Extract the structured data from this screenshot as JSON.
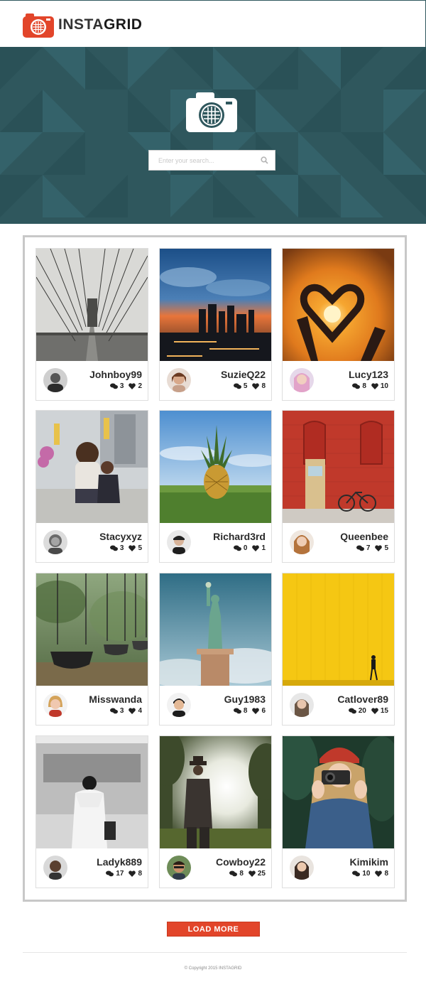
{
  "brand": {
    "insta": "INSTA",
    "grid": "GRID",
    "accent": "#e2452a",
    "hero_color": "#2f575d"
  },
  "search": {
    "placeholder": "Enter your search...",
    "icon": "search-icon"
  },
  "cards": [
    {
      "user": "Johnboy99",
      "comments": "3",
      "likes": "2"
    },
    {
      "user": "SuzieQ22",
      "comments": "5",
      "likes": "8"
    },
    {
      "user": "Lucy123",
      "comments": "8",
      "likes": "10"
    },
    {
      "user": "Stacyxyz",
      "comments": "3",
      "likes": "5"
    },
    {
      "user": "Richard3rd",
      "comments": "0",
      "likes": "1"
    },
    {
      "user": "Queenbee",
      "comments": "7",
      "likes": "5"
    },
    {
      "user": "Misswanda",
      "comments": "3",
      "likes": "4"
    },
    {
      "user": "Guy1983",
      "comments": "8",
      "likes": "6"
    },
    {
      "user": "Catlover89",
      "comments": "20",
      "likes": "15"
    },
    {
      "user": "Ladyk889",
      "comments": "17",
      "likes": "8"
    },
    {
      "user": "Cowboy22",
      "comments": "8",
      "likes": "25"
    },
    {
      "user": "Kimikim",
      "comments": "10",
      "likes": "8"
    }
  ],
  "load_more": "LOAD MORE",
  "footer": {
    "copyright": "© Copyright 2015 INSTAGRID"
  }
}
